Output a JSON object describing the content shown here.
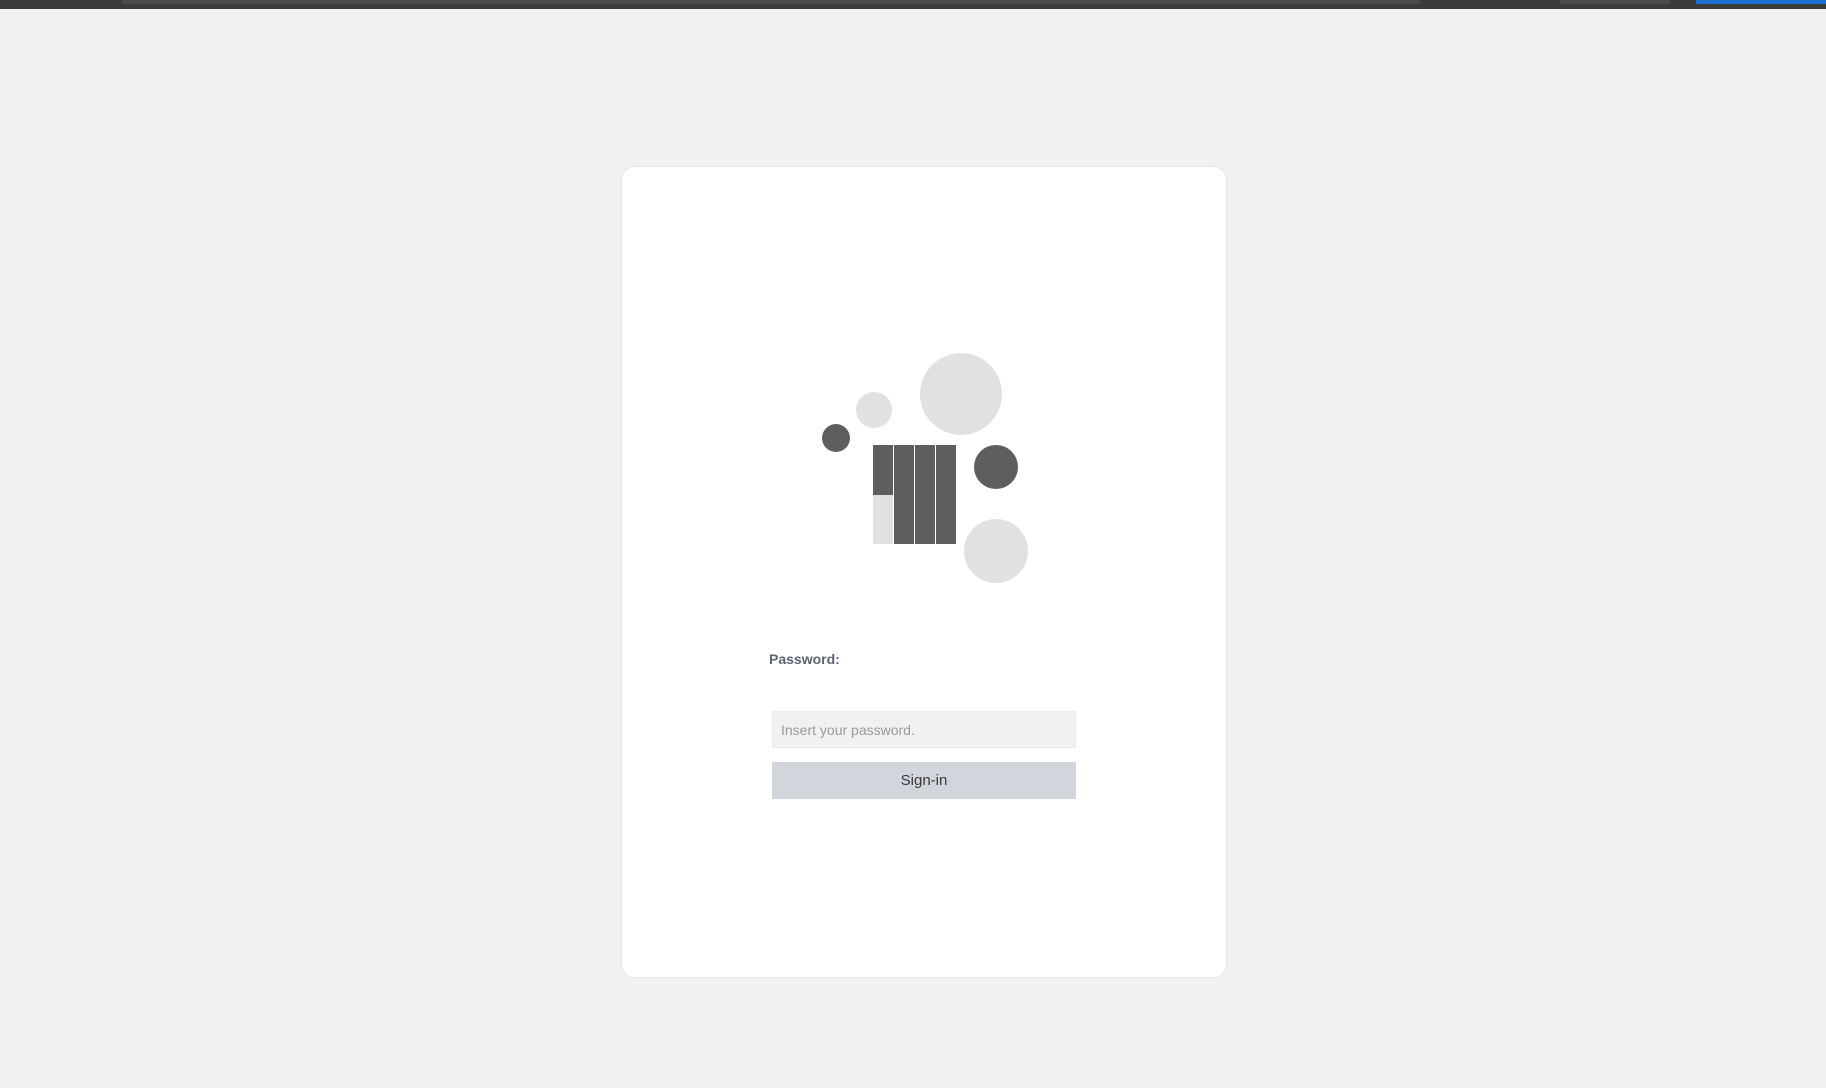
{
  "colors": {
    "background": "#f1f1f1",
    "card": "#ffffff",
    "logo_dark": "#5e5e5e",
    "logo_light": "#e1e1e1",
    "button": "#d3d5dc",
    "accent": "#1b6fd0"
  },
  "logo": {
    "icon": "abstract-bars-and-circles-logo"
  },
  "login": {
    "password_label": "Password:",
    "password_placeholder": "Insert your password.",
    "password_value": "",
    "signin_label": "Sign-in"
  }
}
